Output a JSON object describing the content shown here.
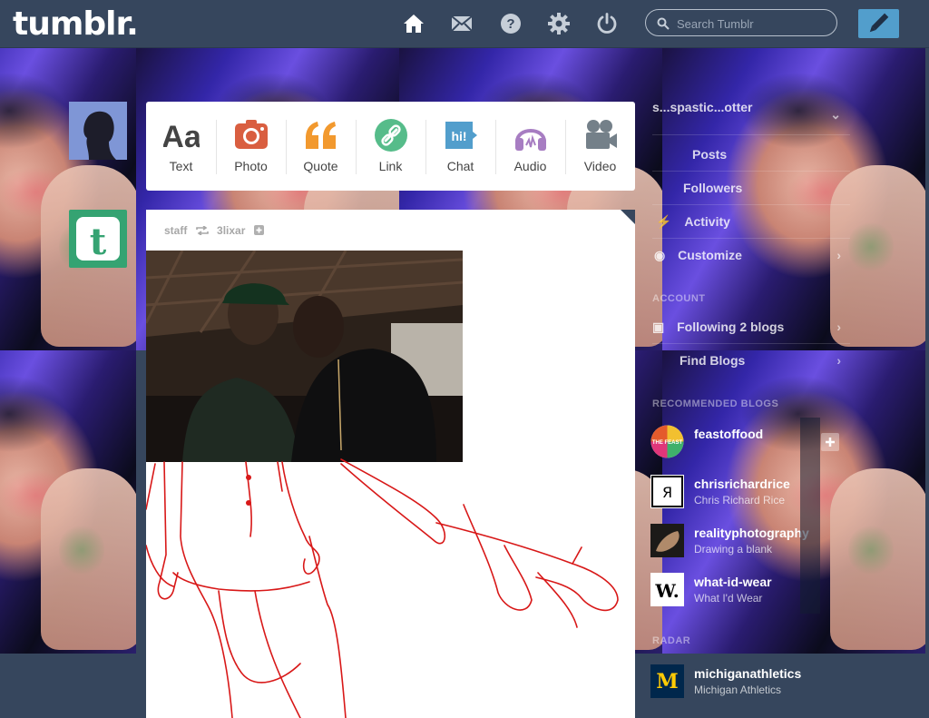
{
  "header": {
    "logo": "tumblr.",
    "search_placeholder": "Search Tumblr",
    "icons": [
      "home-icon",
      "mail-icon",
      "help-icon",
      "gear-icon",
      "power-icon",
      "pencil-icon"
    ]
  },
  "post_types": [
    {
      "label": "Text",
      "icon": "text-icon",
      "color": "#444444"
    },
    {
      "label": "Photo",
      "icon": "camera-icon",
      "color": "#d95e40"
    },
    {
      "label": "Quote",
      "icon": "quote-icon",
      "color": "#f2992e"
    },
    {
      "label": "Link",
      "icon": "link-icon",
      "color": "#56bc8a"
    },
    {
      "label": "Chat",
      "icon": "chat-icon",
      "color": "#529ecc"
    },
    {
      "label": "Audio",
      "icon": "headphones-icon",
      "color": "#a77dc2"
    },
    {
      "label": "Video",
      "icon": "video-camera-icon",
      "color": "#748089"
    }
  ],
  "post": {
    "author": "staff",
    "reblogged_from": "3lixar"
  },
  "sidebar": {
    "blog_name": "s...spastic...otter",
    "menu": [
      {
        "label": "Posts"
      },
      {
        "label": "Followers"
      },
      {
        "label": "Activity"
      },
      {
        "label": "Customize"
      }
    ],
    "account_label": "ACCOUNT",
    "following": "Following 2 blogs",
    "find_blogs": "Find Blogs",
    "recommended_label": "RECOMMENDED BLOGS",
    "blogs": [
      {
        "name": "feastoffood",
        "desc": "",
        "avatar_text": "THE FEAST",
        "avatar_color": "#e0367a"
      },
      {
        "name": "chrisrichardrice",
        "desc": "Chris Richard Rice",
        "avatar_text": "Я",
        "avatar_color": "#ffffff"
      },
      {
        "name": "realityphotography",
        "desc": "Drawing a blank",
        "avatar_text": "",
        "avatar_color": "#8b6e4f"
      },
      {
        "name": "what-id-wear",
        "desc": "What I'd Wear",
        "avatar_text": "W.",
        "avatar_color": "#ffffff"
      }
    ],
    "radar_label": "RADAR",
    "radar_blog": {
      "name": "michiganathletics",
      "desc": "Michigan Athletics",
      "avatar_text": "M",
      "avatar_color": "#00274c"
    }
  }
}
